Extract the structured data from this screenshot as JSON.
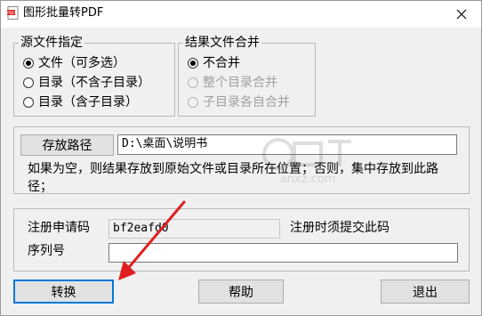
{
  "window": {
    "title": "图形批量转PDF"
  },
  "source_group": {
    "title": "源文件指定",
    "options": [
      {
        "label": "文件（可多选）",
        "checked": true,
        "enabled": true
      },
      {
        "label": "目录（不含子目录）",
        "checked": false,
        "enabled": true
      },
      {
        "label": "目录（含子目录）",
        "checked": false,
        "enabled": true
      }
    ]
  },
  "merge_group": {
    "title": "结果文件合并",
    "options": [
      {
        "label": "不合并",
        "checked": true,
        "enabled": true
      },
      {
        "label": "整个目录合并",
        "checked": false,
        "enabled": false
      },
      {
        "label": "子目录各自合并",
        "checked": false,
        "enabled": false
      }
    ]
  },
  "output": {
    "button_label": "存放路径",
    "path_value": "D:\\桌面\\说明书",
    "note": "如果为空，则结果存放到原始文件或目录所在位置；否则，集中存放到此路径；"
  },
  "registration": {
    "request_label": "注册申请码",
    "request_value": "bf2eafd0",
    "hint": "注册时须提交此码",
    "serial_label": "序列号",
    "serial_value": ""
  },
  "buttons": {
    "convert": "转换",
    "help": "帮助",
    "exit": "退出"
  },
  "watermark": {
    "text": "anxz.com"
  },
  "colors": {
    "arrow": "#e02020",
    "focus": "#0078d7"
  }
}
